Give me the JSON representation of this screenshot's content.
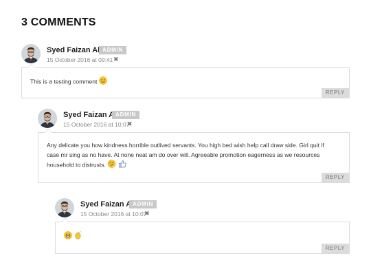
{
  "heading": "3 COMMENTS",
  "comments": [
    {
      "author": "Syed Faizan Ali",
      "badge": "ADMIN",
      "date": "15 October 2016 at 09:41",
      "text": "This is a testing comment",
      "emojis": [
        "slightly-smiling-face"
      ],
      "reply_label": "REPLY"
    },
    {
      "author": "Syed Faizan Ali",
      "badge": "ADMIN",
      "date": "15 October 2016 at 10:07",
      "text": "Any delicate you how kindness horrible outlived servants. You high bed wish help call draw side. Girl quit if case mr sing as no have. At none neat am do over will. Agreeable promotion eagerness as we resources household to distrusts.",
      "emojis": [
        "smirking-face",
        "thumbs-up"
      ],
      "reply_label": "REPLY"
    },
    {
      "author": "Syed Faizan Ali",
      "badge": "ADMIN",
      "date": "15 October 2016 at 10:07",
      "text": "",
      "emojis": [
        "grinning-face",
        "clapping-hands"
      ],
      "reply_label": "REPLY"
    }
  ],
  "colors": {
    "badge_bg": "#c8c8c8",
    "box_border": "#dcdcdc",
    "reply_bg": "#dcdcdc",
    "emoji_yellow": "#f7c531",
    "thumb_blue": "#5b7fbd"
  }
}
